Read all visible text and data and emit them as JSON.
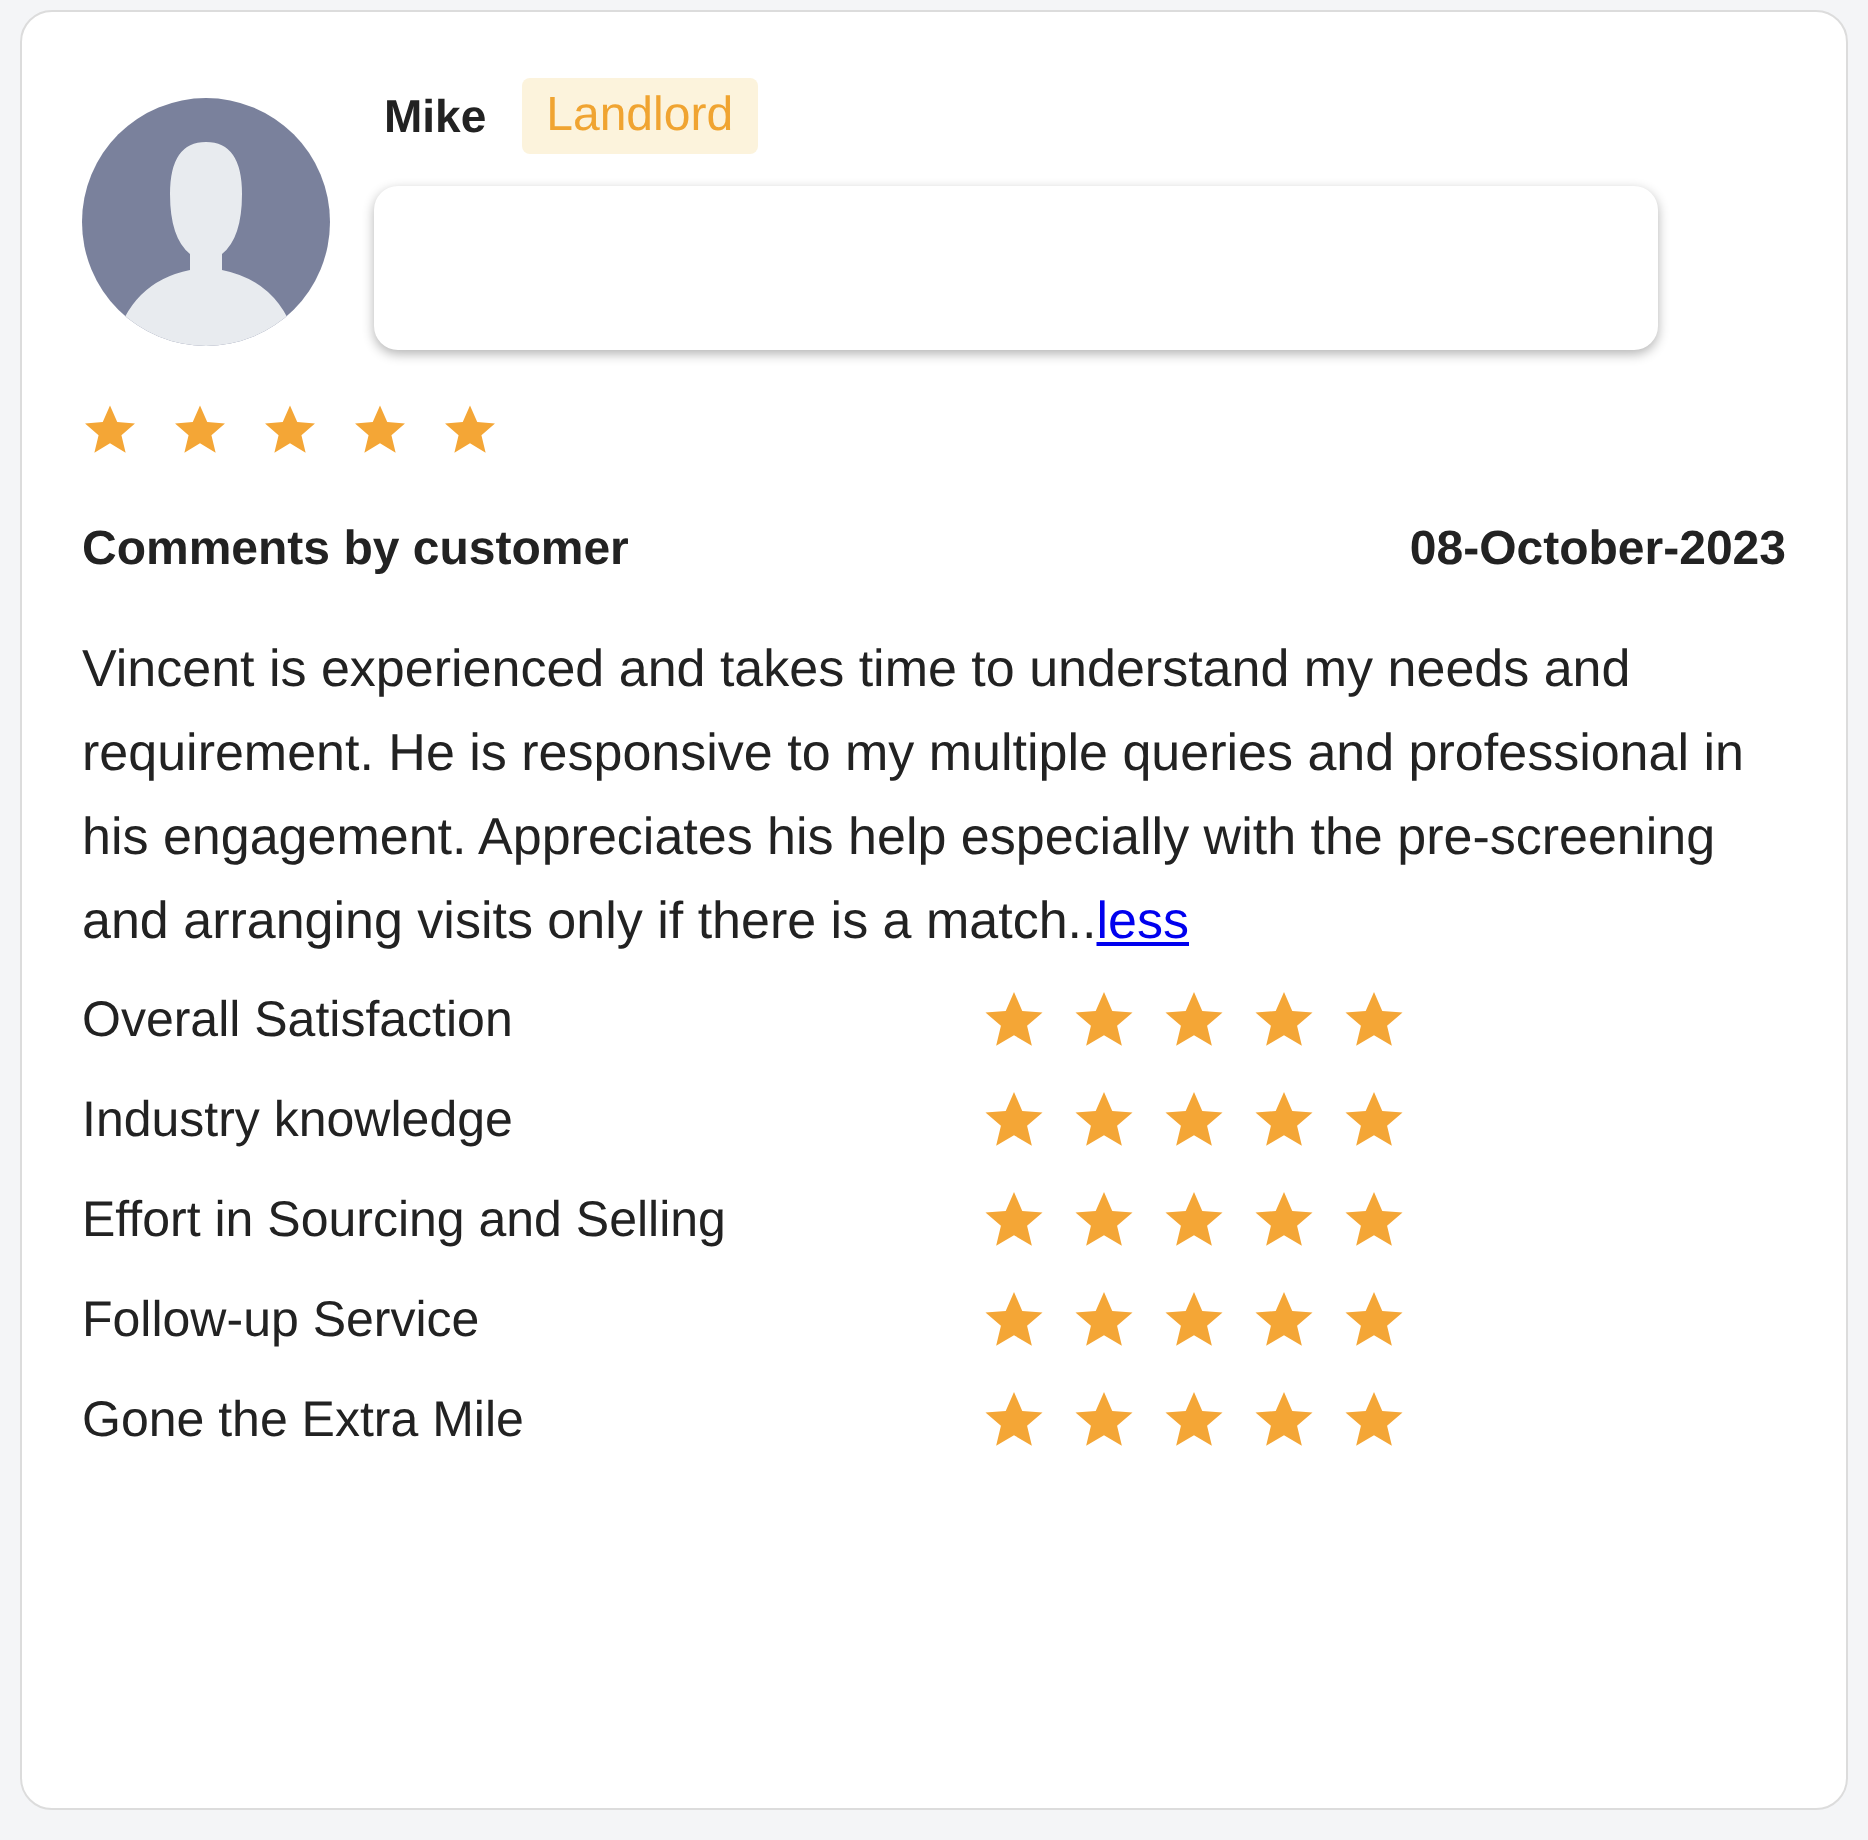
{
  "reviewer": {
    "name": "Mike",
    "role": "Landlord",
    "stars": 5
  },
  "comments": {
    "heading": "Comments by customer",
    "date": "08-October-2023",
    "text": "Vincent is experienced and takes time to understand my needs and requirement. He is responsive to my multiple queries and professional in his engagement. Appreciates his help especially with the pre-screening and arranging visits only if there is a match..",
    "link": "less"
  },
  "ratings": [
    {
      "label": "Overall Satisfaction",
      "stars": 5
    },
    {
      "label": "Industry knowledge",
      "stars": 5
    },
    {
      "label": "Effort in Sourcing and Selling",
      "stars": 5
    },
    {
      "label": "Follow-up Service",
      "stars": 5
    },
    {
      "label": "Gone the Extra Mile",
      "stars": 5
    }
  ]
}
